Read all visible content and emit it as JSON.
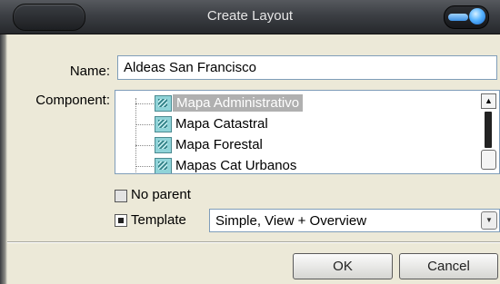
{
  "window": {
    "title": "Create Layout"
  },
  "form": {
    "name_label": "Name:",
    "name_value": "Aldeas San Francisco",
    "component_label": "Component:",
    "components": [
      {
        "label": "Mapa Administrativo",
        "selected": true
      },
      {
        "label": "Mapa Catastral",
        "selected": false
      },
      {
        "label": "Mapa Forestal",
        "selected": false
      },
      {
        "label": "Mapas Cat Urbanos",
        "selected": false
      }
    ],
    "no_parent": {
      "label": "No parent",
      "checked": false
    },
    "template": {
      "label": "Template",
      "checked": true,
      "selected_value": "Simple, View + Overview"
    }
  },
  "buttons": {
    "ok": "OK",
    "cancel": "Cancel"
  },
  "icons": {
    "component": "map-layer-icon",
    "scroll_up": "scroll-up-arrow-icon",
    "dropdown": "dropdown-arrow-icon"
  },
  "colors": {
    "titlebar": "#3c3f44",
    "selection": "#b0b0b0",
    "orb": "#3d8fe0"
  }
}
